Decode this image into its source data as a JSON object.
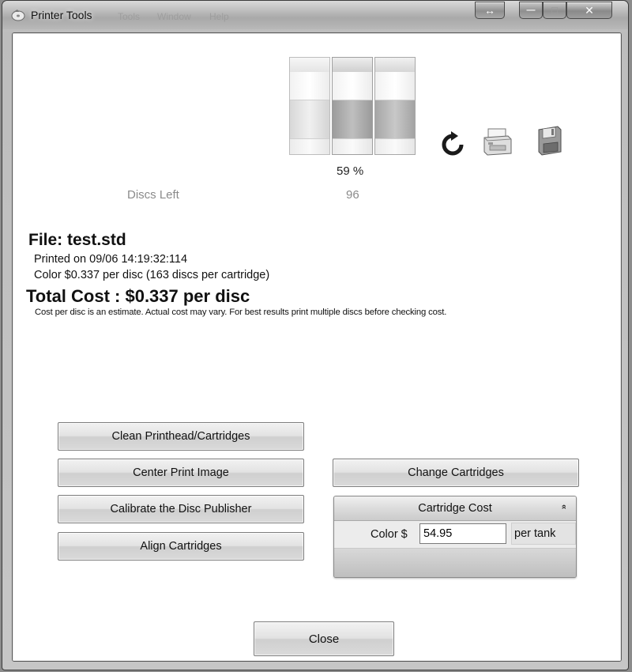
{
  "window": {
    "title": "Printer Tools",
    "ghost_menu": [
      "Tools",
      "Window",
      "Help"
    ],
    "restore_glyph": "↔",
    "minimize_glyph": "—",
    "maximize_glyph": "☐",
    "close_glyph": "✕"
  },
  "gauge": {
    "level_percent": 59,
    "level_label": "59 %",
    "discs_left_label": "Discs Left",
    "discs_left_value": "96"
  },
  "toolbar_icons": [
    "refresh-icon",
    "printer-icon",
    "save-icon"
  ],
  "cost": {
    "file": "File: test.std",
    "printed_on": "Printed on 09/06 14:19:32:114",
    "color_cost": "Color $0.337 per disc (163 discs per cartridge)",
    "total": "Total Cost : $0.337 per disc",
    "note": "Cost per disc is an estimate. Actual cost may vary. For best results print multiple discs before checking cost."
  },
  "buttons": {
    "clean": "Clean Printhead/Cartridges",
    "center": "Center Print Image",
    "calibrate": "Calibrate the Disc Publisher",
    "align": "Align Cartridges",
    "change": "Change Cartridges",
    "close": "Close"
  },
  "cartridge_cost": {
    "header": "Cartridge Cost",
    "chevron": "»",
    "color_label": "Color $",
    "color_value": "54.95",
    "per_tank": "per tank"
  }
}
